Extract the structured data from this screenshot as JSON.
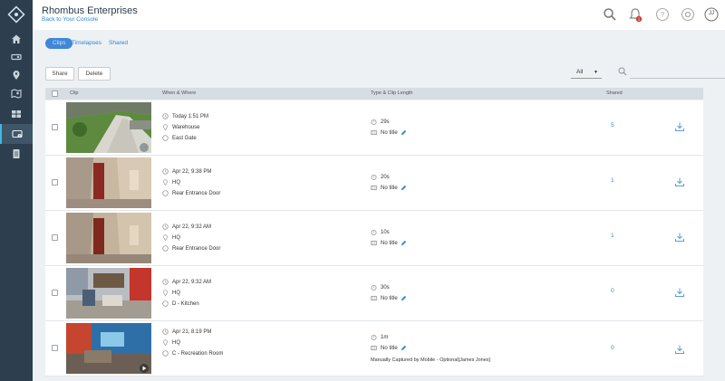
{
  "header": {
    "org_name": "Rhombus Enterprises",
    "back_link": "Back to Your Console",
    "notification_count": "1",
    "user_initials": "JJ"
  },
  "sidebar": {
    "items": [
      {
        "icon": "home-icon"
      },
      {
        "icon": "camera-icon"
      },
      {
        "icon": "location-pin-icon"
      },
      {
        "icon": "map-icon"
      },
      {
        "icon": "video-wall-icon"
      },
      {
        "icon": "clips-icon",
        "active": true
      },
      {
        "icon": "reports-icon"
      }
    ]
  },
  "tabs": [
    {
      "label": "Clips",
      "active": true
    },
    {
      "label": "Timelapses"
    },
    {
      "label": "Shared"
    }
  ],
  "toolbar": {
    "share_label": "Share",
    "delete_label": "Delete",
    "filter_value": "All",
    "search_placeholder": ""
  },
  "table": {
    "columns": {
      "clip": "Clip",
      "when_where": "When & Where",
      "type_length": "Type & Clip Length",
      "shared": "Shared"
    },
    "rows": [
      {
        "time": "Today 1:51 PM",
        "location": "Warehouse",
        "camera": "East Gate",
        "length": "29s",
        "title": "No title",
        "shared": "5",
        "caption": ""
      },
      {
        "time": "Apr 22, 9:38 PM",
        "location": "HQ",
        "camera": "Rear Entrance Door",
        "length": "20s",
        "title": "No title",
        "shared": "1",
        "caption": ""
      },
      {
        "time": "Apr 22, 9:32 AM",
        "location": "HQ",
        "camera": "Rear Entrance Door",
        "length": "10s",
        "title": "No title",
        "shared": "1",
        "caption": ""
      },
      {
        "time": "Apr 22, 9:32 AM",
        "location": "HQ",
        "camera": "D - Kitchen",
        "length": "30s",
        "title": "No title",
        "shared": "0",
        "caption": ""
      },
      {
        "time": "Apr 21, 8:19 PM",
        "location": "HQ",
        "camera": "C - Recreation Room",
        "length": "1m",
        "title": "No title",
        "shared": "0",
        "caption": "Manually Captured by Mobile - Optional[James Jones]"
      }
    ]
  },
  "colors": {
    "sidebar_bg": "#2d3e4e",
    "accent": "#2b87d1",
    "active_tab": "#3f87d8",
    "content_bg": "#eef1f4"
  }
}
